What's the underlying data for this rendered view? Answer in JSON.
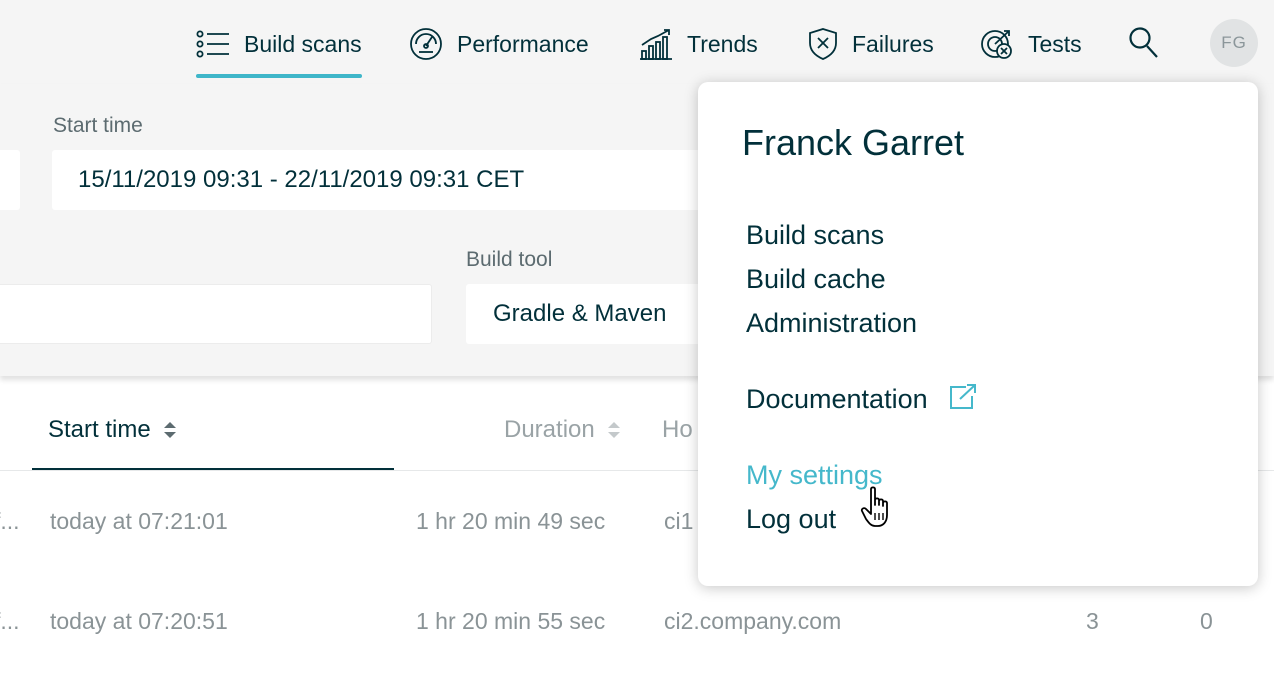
{
  "nav": {
    "items": [
      {
        "label": "Build scans",
        "icon": "list-icon",
        "active": true
      },
      {
        "label": "Performance",
        "icon": "speedometer-icon"
      },
      {
        "label": "Trends",
        "icon": "bar-chart-icon"
      },
      {
        "label": "Failures",
        "icon": "shield-x-icon"
      },
      {
        "label": "Tests",
        "icon": "target-x-icon"
      }
    ],
    "search_icon": "search-icon",
    "avatar_initials": "FG"
  },
  "filters": {
    "start_time_label": "Start time",
    "start_time_value": "15/11/2019 09:31 - 22/11/2019 09:31 CET",
    "build_tool_label": "Build tool",
    "build_tool_value": "Gradle & Maven"
  },
  "table": {
    "columns": [
      "Start time",
      "Duration",
      "Ho"
    ],
    "rows": [
      {
        "lead": "f...",
        "start": "today at 07:21:01",
        "duration": "1 hr 20 min 49 sec",
        "host": "ci1",
        "c1": "",
        "c2": ""
      },
      {
        "lead": "f...",
        "start": "today at 07:20:51",
        "duration": "1 hr 20 min 55 sec",
        "host": "ci2.company.com",
        "c1": "3",
        "c2": "0"
      }
    ]
  },
  "user_menu": {
    "name": "Franck Garret",
    "items": [
      "Build scans",
      "Build cache",
      "Administration"
    ],
    "documentation": "Documentation",
    "my_settings": "My settings",
    "log_out": "Log out"
  },
  "colors": {
    "accent": "#3fb6c9",
    "text": "#02303a",
    "hover_link": "#45b8cb",
    "muted": "#8a9396"
  }
}
